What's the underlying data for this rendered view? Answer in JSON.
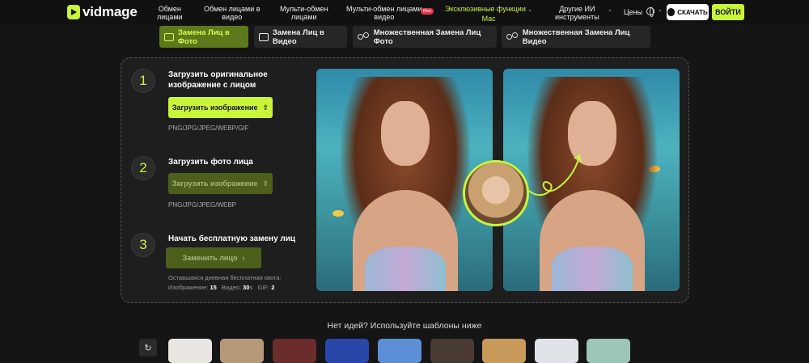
{
  "nav": {
    "logo": "vidmage",
    "items": [
      {
        "label1": "Обмен",
        "label2": "лицами"
      },
      {
        "label1": "Обмен лицами в",
        "label2": "видео"
      },
      {
        "label1": "Мульти-обмен",
        "label2": "лицами"
      },
      {
        "label1": "Мульти-обмен лицами",
        "label2": "видео"
      },
      {
        "label1": "Эксклюзивные функции",
        "label2": "Mac"
      },
      {
        "label1": "Другие ИИ",
        "label2": "инструменты"
      }
    ],
    "new_badge": "New",
    "prices": "Цены",
    "download": "СКАЧАТЬ",
    "login": "ВОЙТИ",
    "accent": "#c8f53a"
  },
  "tabs": [
    {
      "label": "Замена Лиц в Фото",
      "icon": "image-icon",
      "active": true
    },
    {
      "label": "Замена Лиц в Видео",
      "icon": "video-icon",
      "active": false
    },
    {
      "label": "Множественная Замена Лиц Фото",
      "icon": "people-icon",
      "active": false
    },
    {
      "label": "Множественная Замена Лиц Видео",
      "icon": "people-icon",
      "active": false
    }
  ],
  "steps": [
    {
      "num": "1",
      "title1": "Загрузить оригинальное",
      "title2": "изображение с лицом",
      "button": "Загрузить изображение",
      "formats": "PNG/JPG/JPEG/WEBP/GIF"
    },
    {
      "num": "2",
      "title1": "Загрузить фото лица",
      "button": "Загрузить изображение",
      "formats": "PNG/JPG/JPEG/WEBP"
    },
    {
      "num": "3",
      "title1": "Начать бесплатную замену лиц",
      "button": "Заменить лицо"
    }
  ],
  "quota": {
    "label": "Оставшаяся дневная бесплатная квота:",
    "image_label": "Изображение:",
    "image_value": "15",
    "video_label": "Видео:",
    "video_value": "30",
    "video_unit": "s",
    "gif_label": "GIF:",
    "gif_value": "2"
  },
  "templates": {
    "title": "Нет идей? Используйте шаблоны ниже"
  }
}
